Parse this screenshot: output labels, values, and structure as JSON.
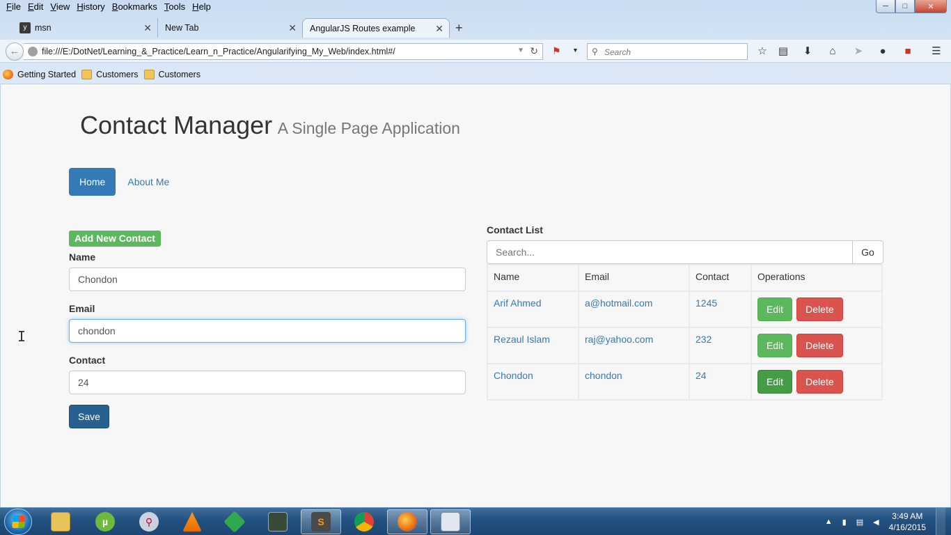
{
  "browser": {
    "menu": [
      {
        "label": "File",
        "u": "F",
        "rest": "ile"
      },
      {
        "label": "Edit",
        "u": "E",
        "rest": "dit"
      },
      {
        "label": "View",
        "u": "V",
        "rest": "iew"
      },
      {
        "label": "History",
        "u": "H",
        "rest": "istory"
      },
      {
        "label": "Bookmarks",
        "u": "B",
        "rest": "ookmarks"
      },
      {
        "label": "Tools",
        "u": "T",
        "rest": "ools"
      },
      {
        "label": "Help",
        "u": "H",
        "rest": "elp"
      }
    ],
    "tabs": {
      "msn": "msn",
      "newtab": "New Tab",
      "active": "AngularJS Routes example"
    },
    "url": "file:///E:/DotNet/Learning_&_Practice/Learn_n_Practice/Angularifying_My_Web/index.html#/",
    "search_placeholder": "Search",
    "bookmarks": [
      "Getting Started",
      "Customers",
      "Customers"
    ]
  },
  "app": {
    "title": "Contact Manager",
    "subtitle": "A Single Page Application",
    "nav": {
      "home": "Home",
      "about": "About Me"
    },
    "form": {
      "badge": "Add New Contact",
      "name_label": "Name",
      "name_value": "Chondon",
      "email_label": "Email",
      "email_value": "chondon",
      "contact_label": "Contact",
      "contact_value": "24",
      "save": "Save"
    },
    "list": {
      "label": "Contact List",
      "search_placeholder": "Search...",
      "go": "Go",
      "columns": [
        "Name",
        "Email",
        "Contact",
        "Operations"
      ],
      "rows": [
        {
          "name": "Arif Ahmed",
          "email": "a@hotmail.com",
          "contact": "1245"
        },
        {
          "name": "Rezaul Islam",
          "email": "raj@yahoo.com",
          "contact": "232"
        },
        {
          "name": "Chondon",
          "email": "chondon",
          "contact": "24"
        }
      ],
      "edit": "Edit",
      "delete": "Delete"
    }
  },
  "taskbar": {
    "time": "3:49 AM",
    "date": "4/16/2015"
  },
  "colors": {
    "primary": "#337ab7",
    "success": "#5cb85c",
    "danger": "#d9534f"
  }
}
